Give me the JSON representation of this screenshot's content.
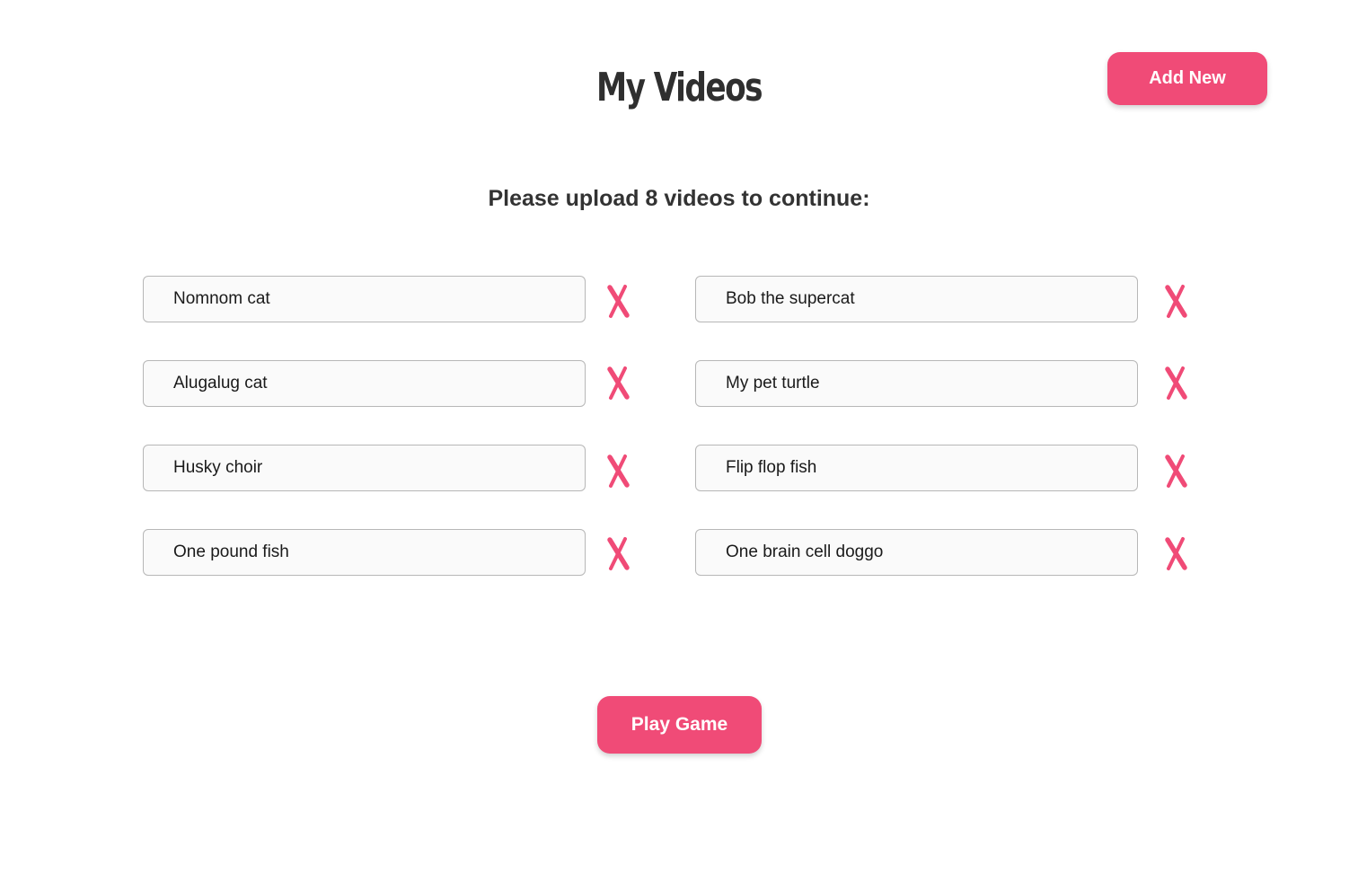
{
  "header": {
    "title": "My Videos",
    "add_new_label": "Add New"
  },
  "main": {
    "instruction": "Please upload 8 videos to continue:",
    "videos": [
      {
        "value": "Nomnom cat"
      },
      {
        "value": "Bob the supercat"
      },
      {
        "value": "Alugalug cat"
      },
      {
        "value": "My pet turtle"
      },
      {
        "value": "Husky choir"
      },
      {
        "value": "Flip flop fish"
      },
      {
        "value": "One pound fish"
      },
      {
        "value": "One brain cell doggo"
      }
    ],
    "delete_icon": "close-x-icon"
  },
  "footer": {
    "play_label": "Play Game"
  },
  "colors": {
    "accent": "#f04b77",
    "text": "#333333",
    "field_border": "#b7b7b7",
    "field_bg": "#fafafa"
  }
}
